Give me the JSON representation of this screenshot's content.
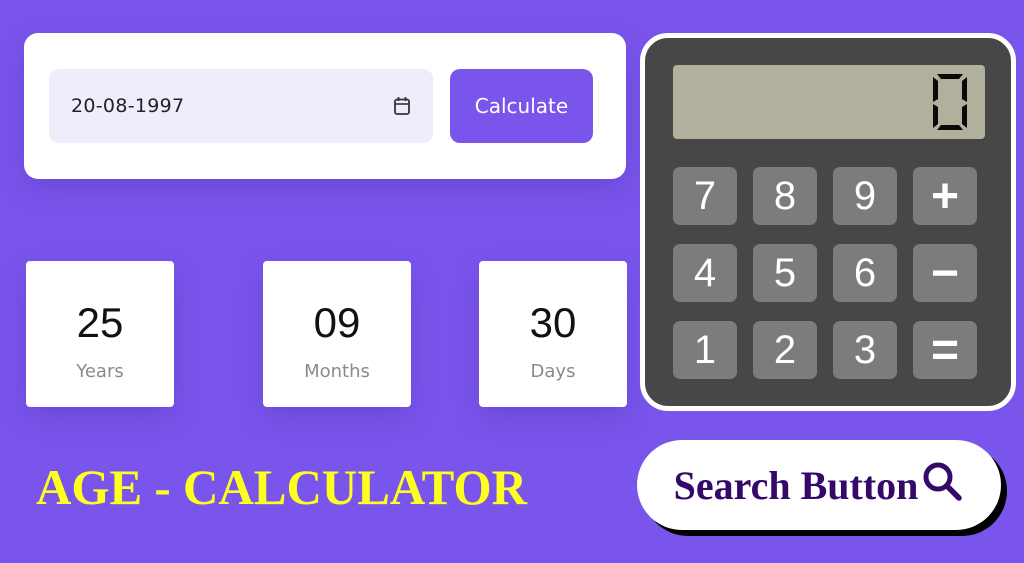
{
  "form": {
    "date_value": "20-08-1997",
    "calendar_icon": "calendar-icon",
    "calculate_label": "Calculate"
  },
  "results": [
    {
      "value": "25",
      "label": "Years"
    },
    {
      "value": "09",
      "label": "Months"
    },
    {
      "value": "30",
      "label": "Days"
    }
  ],
  "calculator": {
    "display_value": "0",
    "keys": [
      "7",
      "8",
      "9",
      "+",
      "4",
      "5",
      "6",
      "−",
      "1",
      "2",
      "3",
      "="
    ]
  },
  "title": "AGE - CALCULATOR",
  "search_button": {
    "label": "Search Button",
    "icon": "search-icon"
  },
  "colors": {
    "background": "#7a55ec",
    "accent": "#7a55ec",
    "title": "#ffff1e",
    "search_text": "#35096a",
    "calc_body": "#474747",
    "calc_display": "#b1b09c",
    "calc_key": "#7c7c7c"
  }
}
